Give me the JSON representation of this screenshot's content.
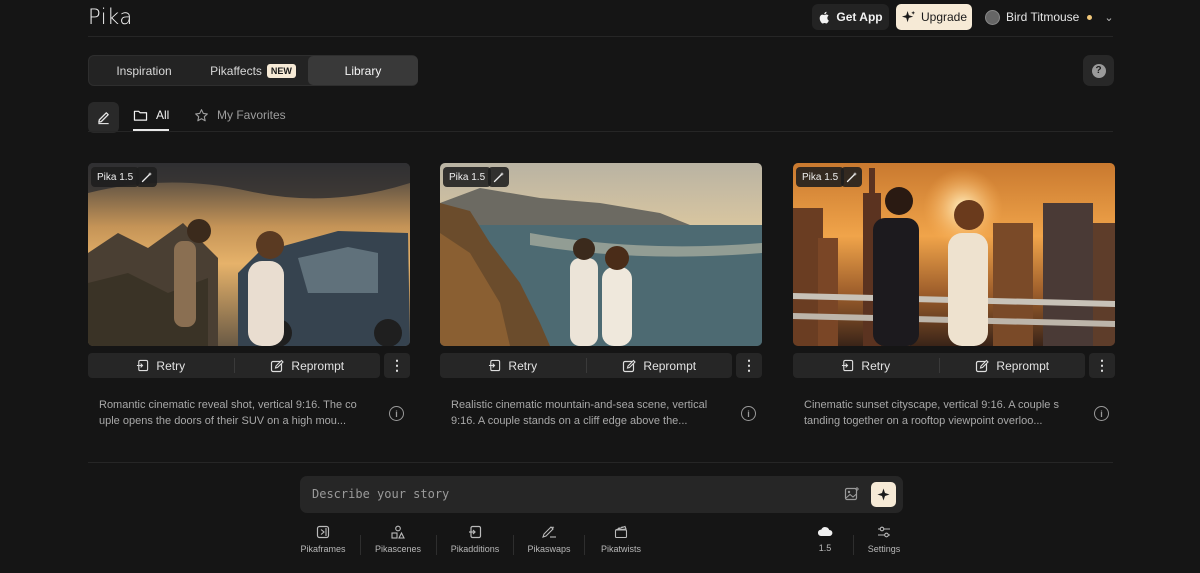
{
  "app": {
    "logo": "Pika"
  },
  "header": {
    "get_app_label": "Get App",
    "upgrade_label": "Upgrade",
    "user_name": "Bird Titmouse"
  },
  "tabs": [
    {
      "label": "Inspiration"
    },
    {
      "label": "Pikaffects",
      "badge": "NEW"
    },
    {
      "label": "Library",
      "active": true
    }
  ],
  "help_label": "?",
  "filters": {
    "all": "All",
    "favorites": "My Favorites"
  },
  "cards": [
    {
      "model": "Pika 1.5",
      "retry_label": "Retry",
      "reprompt_label": "Reprompt",
      "more_label": "⋮",
      "description": "Romantic cinematic reveal shot, vertical 9:16. The co uple opens the doors of their SUV on a high mou..."
    },
    {
      "model": "Pika 1.5",
      "retry_label": "Retry",
      "reprompt_label": "Reprompt",
      "more_label": "⋮",
      "description": "Realistic cinematic mountain-and-sea scene, vertical 9:16. A couple stands on a cliff edge above the..."
    },
    {
      "model": "Pika 1.5",
      "retry_label": "Retry",
      "reprompt_label": "Reprompt",
      "more_label": "⋮",
      "description": "Cinematic sunset cityscape, vertical 9:16. A couple s tanding together on a rooftop viewpoint overloo..."
    }
  ],
  "prompt": {
    "placeholder": "Describe your story"
  },
  "tools": [
    {
      "label": "Pikaframes",
      "icon": "frames-icon"
    },
    {
      "label": "Pikascenes",
      "icon": "shapes-icon"
    },
    {
      "label": "Pikadditions",
      "icon": "add-in-icon"
    },
    {
      "label": "Pikaswaps",
      "icon": "brush-swap-icon"
    },
    {
      "label": "Pikatwists",
      "icon": "clapper-icon"
    }
  ],
  "model_selector": {
    "label": "1.5",
    "icon": "cloud-icon"
  },
  "settings": {
    "label": "Settings",
    "icon": "sliders-icon"
  },
  "colors": {
    "background": "#151515",
    "accent": "#f6ead6",
    "surface": "#262626"
  }
}
